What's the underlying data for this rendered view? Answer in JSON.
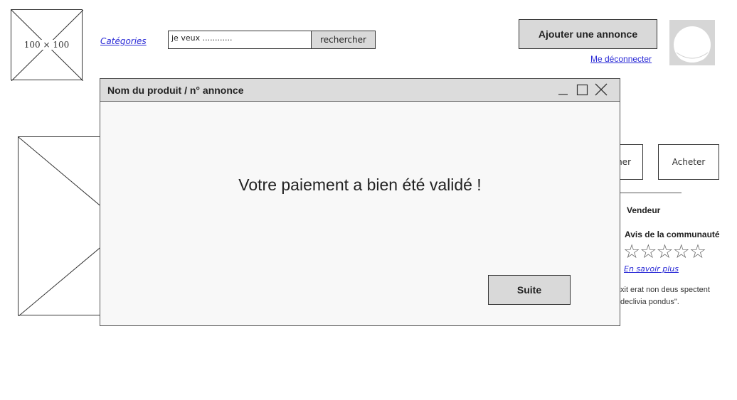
{
  "header": {
    "logo_label": "100 × 100",
    "categories_link": "Catégories",
    "search": {
      "value": "je veux ............",
      "button_label": "rechercher"
    },
    "add_listing_button": "Ajouter une annonce",
    "logout_link": "Me déconnecter",
    "avatar_icon": "user-avatar-icon"
  },
  "product_page": {
    "partial_button_label": "ner",
    "buy_button_label": "Acheter",
    "seller_heading": "Vendeur",
    "community_reviews_heading": "Avis de la communauté",
    "rating": {
      "filled": 0,
      "total": 5,
      "text": "☆☆☆☆☆"
    },
    "learn_more_link": "En savoir plus",
    "description_line_1": "xit erat non deus spectent",
    "description_line_2": "declivia pondus\"."
  },
  "modal": {
    "title": "Nom du produit / n° annonce",
    "controls": [
      "minimize-icon",
      "maximize-icon",
      "close-icon"
    ],
    "message": "Votre paiement a bien été validé !",
    "next_button": "Suite"
  }
}
